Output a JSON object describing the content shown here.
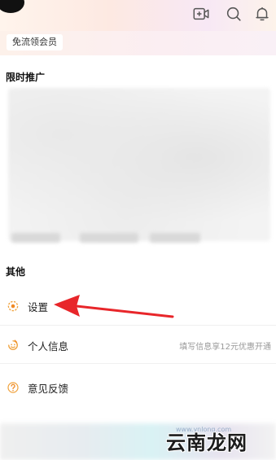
{
  "header": {
    "icons": [
      "video-add-icon",
      "search-icon",
      "bell-icon"
    ]
  },
  "vip": {
    "label": "免流领会员"
  },
  "promo": {
    "title": "限时推广"
  },
  "other": {
    "title": "其他"
  },
  "menu": {
    "settings": {
      "label": "设置",
      "icon": "gear-icon"
    },
    "personal_info": {
      "label": "个人信息",
      "hint": "填写信息享12元优惠开通",
      "icon": "smile-icon"
    },
    "feedback": {
      "label": "意见反馈",
      "icon": "question-icon"
    }
  },
  "annotation": {
    "arrow_color": "#e8262a"
  },
  "watermark": {
    "text": "云南龙网",
    "small_text": "www.ynlong.com"
  },
  "colors": {
    "accent": "#f08a24"
  }
}
